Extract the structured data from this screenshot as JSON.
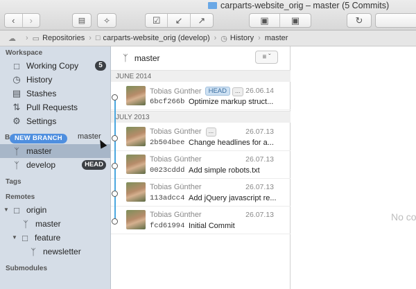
{
  "window": {
    "title": "carparts-website_orig – master (5 Commits)"
  },
  "toolbar": {
    "icons": [
      "back-icon",
      "forward-icon",
      "sidebar-icon",
      "magic-wand-icon",
      "commit-icon",
      "pull-icon",
      "push-icon",
      "stash-icon",
      "apply-stash-icon",
      "refresh-icon"
    ]
  },
  "breadcrumb": {
    "items": [
      {
        "label": "Repositories",
        "icon": "hdd-icon"
      },
      {
        "label": "carparts-website_orig (develop)",
        "icon": "folder-icon"
      },
      {
        "label": "History",
        "icon": "clock-icon"
      },
      {
        "label": "master",
        "icon": ""
      }
    ]
  },
  "sidebar": {
    "workspace_header": "Workspace",
    "workspace": [
      {
        "label": "Working Copy",
        "icon": "folder-icon",
        "badge": "5"
      },
      {
        "label": "History",
        "icon": "clock-icon"
      },
      {
        "label": "Stashes",
        "icon": "stash-icon"
      },
      {
        "label": "Pull Requests",
        "icon": "pull-request-icon"
      },
      {
        "label": "Settings",
        "icon": "gear-icon"
      }
    ],
    "branches_header": "Br",
    "drag_label": "NEW BRANCH",
    "branches": [
      {
        "label": "master",
        "icon": "branch-icon",
        "selected": true
      },
      {
        "label": "develop",
        "icon": "branch-icon",
        "badge": "HEAD"
      }
    ],
    "tags_header": "Tags",
    "remotes_header": "Remotes",
    "remotes": {
      "origin": "origin",
      "master": "master",
      "feature": "feature",
      "newsletter": "newsletter"
    },
    "submodules_header": "Submodules"
  },
  "history": {
    "branch": "master",
    "months": [
      "JUNE 2014",
      "JULY 2013"
    ],
    "commits": [
      {
        "author": "Tobias Günther",
        "hash": "6bcf266b",
        "message": "Optimize markup struct...",
        "date": "26.06.14",
        "tag": "HEAD",
        "more": "..."
      },
      {
        "author": "Tobias Günther",
        "hash": "2b504bee",
        "message": "Change headlines for a...",
        "date": "26.07.13",
        "more": "..."
      },
      {
        "author": "Tobias Günther",
        "hash": "0023cddd",
        "message": "Add simple robots.txt",
        "date": "26.07.13"
      },
      {
        "author": "Tobias Günther",
        "hash": "113adcc4",
        "message": "Add jQuery javascript re...",
        "date": "26.07.13"
      },
      {
        "author": "Tobias Günther",
        "hash": "fcd61994",
        "message": "Initial Commit",
        "date": "26.07.13"
      }
    ]
  },
  "detail": {
    "empty_text": "No co"
  }
}
